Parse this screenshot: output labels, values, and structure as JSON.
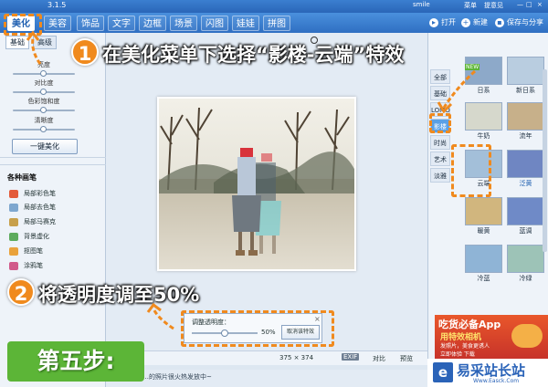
{
  "app": {
    "title": "3.1.5",
    "right_title": "smile",
    "menu_link": "菜单",
    "feedback_link": "提意见"
  },
  "menu": {
    "tabs": [
      "美化",
      "美容",
      "饰品",
      "文字",
      "边框",
      "场景",
      "闪图",
      "娃娃",
      "拼图"
    ],
    "active": 0
  },
  "toolbar": {
    "open": "打开",
    "new": "新建",
    "save": "保存与分享"
  },
  "left": {
    "subtabs": [
      "基础",
      "高级"
    ],
    "sliders": [
      {
        "label": "亮度",
        "value": 0.5
      },
      {
        "label": "对比度",
        "value": 0.5
      },
      {
        "label": "色彩饱和度",
        "value": 0.5
      },
      {
        "label": "清晰度",
        "value": 0.5
      }
    ],
    "one_click": "一键美化",
    "brush_header": "各种画笔",
    "brushes": [
      {
        "label": "局部彩色笔",
        "color": "#e35b3a"
      },
      {
        "label": "局部去色笔",
        "color": "#7ea7cf"
      },
      {
        "label": "局部马赛克",
        "color": "#c7a04b"
      },
      {
        "label": "背景虚化",
        "color": "#5dab5d"
      },
      {
        "label": "抠图笔",
        "color": "#e9a23b"
      },
      {
        "label": "涂鸦笔",
        "color": "#d15a8a"
      }
    ]
  },
  "right": {
    "categories": [
      "全部",
      "基础",
      "LOMO",
      "影楼",
      "时尚",
      "艺术",
      "淡雅"
    ],
    "active_category": 3,
    "new_badge": "NEW",
    "effects": [
      {
        "label": "日系",
        "color": "#8da9c9"
      },
      {
        "label": "新日系",
        "color": "#b9cde0"
      },
      {
        "label": "牛奶",
        "color": "#d6d8cc"
      },
      {
        "label": "流年",
        "color": "#c7b08a"
      },
      {
        "label": "云端",
        "color": "#a3bfd9"
      },
      {
        "label": "泛黄",
        "color": "#6f86c2"
      },
      {
        "label": "暖黄",
        "color": "#d1b67e"
      },
      {
        "label": "蓝调",
        "color": "#6f8ac7"
      },
      {
        "label": "冷蓝",
        "color": "#8fb4d6"
      },
      {
        "label": "冷绿",
        "color": "#9dc3b7"
      }
    ],
    "selected_effect": 4
  },
  "opacity_panel": {
    "label": "调整透明度：",
    "value_pct": 50,
    "value_text": "50%",
    "cancel": "取消该特效"
  },
  "status": {
    "dimensions": "375 × 374",
    "exif": "EXIF",
    "compare": "对比",
    "preview": "预览",
    "marquee": "…的照片很火热发放中~"
  },
  "callouts": {
    "step1_num": "1",
    "step1_text": "在美化菜单下选择“影楼-云端”特效",
    "step2_num": "2",
    "step2_text": "将透明度调至50%",
    "step5": "第五步:"
  },
  "ad": {
    "title": "吃货必备App",
    "line2": "用特效相机",
    "line3": "发照片，美食更诱人",
    "line4": "立即体验 下载"
  },
  "watermark": {
    "text": "易采站长站",
    "subtext": "Www.Easck.Com"
  },
  "colors": {
    "accent": "#2f6fc2",
    "callout": "#f08a1e",
    "step": "#5cb537"
  }
}
